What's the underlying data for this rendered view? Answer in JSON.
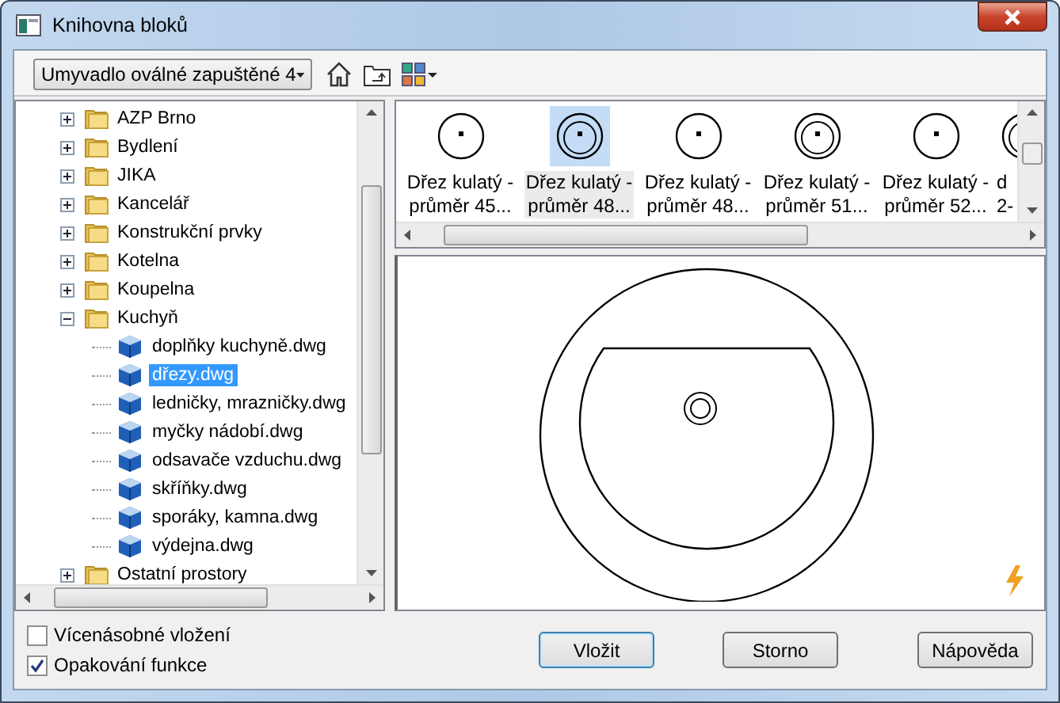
{
  "window": {
    "title": "Knihovna bloků"
  },
  "toolbar": {
    "dropdown_value": "Umyvadlo oválné zapuštěné 4"
  },
  "tree": [
    {
      "kind": "folder",
      "label": "AZP Brno",
      "expanded": false,
      "selected": false
    },
    {
      "kind": "folder",
      "label": "Bydlení",
      "expanded": false,
      "selected": false
    },
    {
      "kind": "folder",
      "label": "JIKA",
      "expanded": false,
      "selected": false
    },
    {
      "kind": "folder",
      "label": "Kancelář",
      "expanded": false,
      "selected": false
    },
    {
      "kind": "folder",
      "label": "Konstrukční prvky",
      "expanded": false,
      "selected": false
    },
    {
      "kind": "folder",
      "label": "Kotelna",
      "expanded": false,
      "selected": false
    },
    {
      "kind": "folder",
      "label": "Koupelna",
      "expanded": false,
      "selected": false
    },
    {
      "kind": "folder",
      "label": "Kuchyň",
      "expanded": true,
      "selected": false,
      "children": [
        {
          "kind": "file",
          "label": "doplňky kuchyně.dwg",
          "selected": false
        },
        {
          "kind": "file",
          "label": "dřezy.dwg",
          "selected": true
        },
        {
          "kind": "file",
          "label": "ledničky, mrazničky.dwg",
          "selected": false
        },
        {
          "kind": "file",
          "label": "myčky nádobí.dwg",
          "selected": false
        },
        {
          "kind": "file",
          "label": "odsavače vzduchu.dwg",
          "selected": false
        },
        {
          "kind": "file",
          "label": "skříňky.dwg",
          "selected": false
        },
        {
          "kind": "file",
          "label": "sporáky, kamna.dwg",
          "selected": false
        },
        {
          "kind": "file",
          "label": "výdejna.dwg",
          "selected": false
        }
      ]
    },
    {
      "kind": "folder",
      "label": "Ostatní prostory",
      "expanded": false,
      "selected": false
    }
  ],
  "thumbnails": [
    {
      "label": "Dřez kulatý -\nprůměr 45...",
      "selected": false
    },
    {
      "label": "Dřez kulatý -\nprůměr 48...",
      "selected": true
    },
    {
      "label": "Dřez kulatý -\nprůměr 48...",
      "selected": false
    },
    {
      "label": "Dřez kulatý -\nprůměr 51...",
      "selected": false
    },
    {
      "label": "Dřez kulatý -\nprůměr 52...",
      "selected": false
    },
    {
      "label": "d\n2-",
      "selected": false
    }
  ],
  "options": [
    {
      "label": "Vícenásobné vložení",
      "checked": false
    },
    {
      "label": "Opakování funkce",
      "checked": true
    }
  ],
  "buttons": [
    {
      "label": "Vložit",
      "default": true
    },
    {
      "label": "Storno",
      "default": false
    },
    {
      "label": "Nápověda",
      "default": false
    }
  ]
}
